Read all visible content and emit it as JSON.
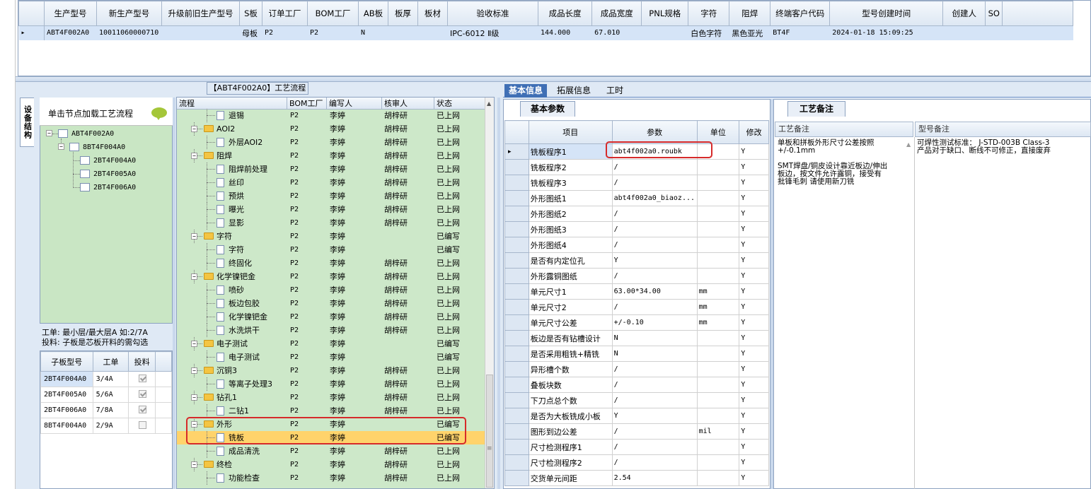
{
  "top_grid": {
    "headers": [
      "生产型号",
      "新生产型号",
      "升级前旧生产型号",
      "S板",
      "订单工厂",
      "BOM工厂",
      "AB板",
      "板厚",
      "板材",
      "验收标准",
      "成品长度",
      "成品宽度",
      "PNL规格",
      "字符",
      "阻焊",
      "终端客户代码",
      "型号创建时间",
      "创建人",
      "SO"
    ],
    "row": [
      "ABT4F002A0",
      "10011060000710",
      "",
      "母板",
      "P2",
      "P2",
      "N",
      "",
      "",
      "IPC-6012 Ⅱ级",
      "144.000",
      "67.010",
      "",
      "白色字符",
      "黑色亚光",
      "BT4F",
      "2024-01-18 15:09:25",
      "",
      ""
    ]
  },
  "side_tab": "设备结构",
  "tree_panel": {
    "header": "单击节点加载工艺流程",
    "nodes": [
      "ABT4F002A0",
      "8BT4F004A0",
      "2BT4F004A0",
      "2BT4F005A0",
      "2BT4F006A0"
    ]
  },
  "hint": {
    "line1": "工单: 最小层/最大层A 如:2/7A",
    "line2": "投料: 子板是芯板开料的需勾选"
  },
  "sub_grid": {
    "headers": [
      "子板型号",
      "工单",
      "投料"
    ],
    "rows": [
      {
        "model": "2BT4F004A0",
        "order": "3/4A",
        "checked": true
      },
      {
        "model": "2BT4F005A0",
        "order": "5/6A",
        "checked": true
      },
      {
        "model": "2BT4F006A0",
        "order": "7/8A",
        "checked": true
      },
      {
        "model": "8BT4F004A0",
        "order": "2/9A",
        "checked": false
      }
    ]
  },
  "process": {
    "title": "【ABT4F002A0】工艺流程",
    "headers": [
      "流程",
      "BOM工厂",
      "编写人",
      "核审人",
      "状态"
    ],
    "rows": [
      {
        "name": "退锡",
        "type": "doc",
        "bom": "P2",
        "writer": "李婷",
        "reviewer": "胡梓研",
        "status": "已上网"
      },
      {
        "name": "AOI2",
        "type": "folder",
        "bom": "P2",
        "writer": "李婷",
        "reviewer": "胡梓研",
        "status": "已上网"
      },
      {
        "name": "外层AOI2",
        "type": "doc",
        "bom": "P2",
        "writer": "李婷",
        "reviewer": "胡梓研",
        "status": "已上网"
      },
      {
        "name": "阻焊",
        "type": "folder",
        "bom": "P2",
        "writer": "李婷",
        "reviewer": "胡梓研",
        "status": "已上网"
      },
      {
        "name": "阻焊前处理",
        "type": "doc",
        "bom": "P2",
        "writer": "李婷",
        "reviewer": "胡梓研",
        "status": "已上网"
      },
      {
        "name": "丝印",
        "type": "doc",
        "bom": "P2",
        "writer": "李婷",
        "reviewer": "胡梓研",
        "status": "已上网"
      },
      {
        "name": "预烘",
        "type": "doc",
        "bom": "P2",
        "writer": "李婷",
        "reviewer": "胡梓研",
        "status": "已上网"
      },
      {
        "name": "曝光",
        "type": "doc",
        "bom": "P2",
        "writer": "李婷",
        "reviewer": "胡梓研",
        "status": "已上网"
      },
      {
        "name": "显影",
        "type": "doc",
        "bom": "P2",
        "writer": "李婷",
        "reviewer": "胡梓研",
        "status": "已上网"
      },
      {
        "name": "字符",
        "type": "folder",
        "bom": "P2",
        "writer": "李婷",
        "reviewer": "",
        "status": "已编写"
      },
      {
        "name": "字符",
        "type": "doc",
        "bom": "P2",
        "writer": "李婷",
        "reviewer": "",
        "status": "已编写"
      },
      {
        "name": "终固化",
        "type": "doc",
        "bom": "P2",
        "writer": "李婷",
        "reviewer": "胡梓研",
        "status": "已上网"
      },
      {
        "name": "化学镍钯金",
        "type": "folder",
        "bom": "P2",
        "writer": "李婷",
        "reviewer": "胡梓研",
        "status": "已上网"
      },
      {
        "name": "喷砂",
        "type": "doc",
        "bom": "P2",
        "writer": "李婷",
        "reviewer": "胡梓研",
        "status": "已上网"
      },
      {
        "name": "板边包胶",
        "type": "doc",
        "bom": "P2",
        "writer": "李婷",
        "reviewer": "胡梓研",
        "status": "已上网"
      },
      {
        "name": "化学镍钯金",
        "type": "doc",
        "bom": "P2",
        "writer": "李婷",
        "reviewer": "胡梓研",
        "status": "已上网"
      },
      {
        "name": "水洗烘干",
        "type": "doc",
        "bom": "P2",
        "writer": "李婷",
        "reviewer": "胡梓研",
        "status": "已上网"
      },
      {
        "name": "电子测试",
        "type": "folder",
        "bom": "P2",
        "writer": "李婷",
        "reviewer": "",
        "status": "已编写"
      },
      {
        "name": "电子测试",
        "type": "doc",
        "bom": "P2",
        "writer": "李婷",
        "reviewer": "",
        "status": "已编写"
      },
      {
        "name": "沉铜3",
        "type": "folder",
        "bom": "P2",
        "writer": "李婷",
        "reviewer": "胡梓研",
        "status": "已上网"
      },
      {
        "name": "等离子处理3",
        "type": "doc",
        "bom": "P2",
        "writer": "李婷",
        "reviewer": "胡梓研",
        "status": "已上网"
      },
      {
        "name": "钻孔1",
        "type": "folder",
        "bom": "P2",
        "writer": "李婷",
        "reviewer": "胡梓研",
        "status": "已上网"
      },
      {
        "name": "二钻1",
        "type": "doc",
        "bom": "P2",
        "writer": "李婷",
        "reviewer": "胡梓研",
        "status": "已上网"
      },
      {
        "name": "外形",
        "type": "folder",
        "bom": "P2",
        "writer": "李婷",
        "reviewer": "",
        "status": "已编写"
      },
      {
        "name": "铣板",
        "type": "doc",
        "bom": "P2",
        "writer": "李婷",
        "reviewer": "",
        "status": "已编写",
        "selected": true
      },
      {
        "name": "成品清洗",
        "type": "doc",
        "bom": "P2",
        "writer": "李婷",
        "reviewer": "胡梓研",
        "status": "已上网"
      },
      {
        "name": "终检",
        "type": "folder",
        "bom": "P2",
        "writer": "李婷",
        "reviewer": "胡梓研",
        "status": "已上网"
      },
      {
        "name": "功能检查",
        "type": "doc",
        "bom": "P2",
        "writer": "李婷",
        "reviewer": "胡梓研",
        "status": "已上网"
      }
    ]
  },
  "right_tabs": [
    "基本信息",
    "拓展信息",
    "工时"
  ],
  "basic_params": {
    "tab": "基本参数",
    "headers": [
      "项目",
      "参数",
      "单位",
      "修改"
    ],
    "rows": [
      {
        "item": "铣板程序1",
        "param": "abt4f002a0.roubk",
        "unit": "",
        "mod": "Y"
      },
      {
        "item": "铣板程序2",
        "param": "/",
        "unit": "",
        "mod": "Y"
      },
      {
        "item": "铣板程序3",
        "param": "/",
        "unit": "",
        "mod": "Y"
      },
      {
        "item": "外形图纸1",
        "param": "abt4f002a0_biaoz...",
        "unit": "",
        "mod": "Y"
      },
      {
        "item": "外形图纸2",
        "param": "/",
        "unit": "",
        "mod": "Y"
      },
      {
        "item": "外形图纸3",
        "param": "/",
        "unit": "",
        "mod": "Y"
      },
      {
        "item": "外形图纸4",
        "param": "/",
        "unit": "",
        "mod": "Y"
      },
      {
        "item": "是否有内定位孔",
        "param": "Y",
        "unit": "",
        "mod": "Y"
      },
      {
        "item": "外形露铜图纸",
        "param": "/",
        "unit": "",
        "mod": "Y"
      },
      {
        "item": "单元尺寸1",
        "param": "63.00*34.00",
        "unit": "mm",
        "mod": "Y"
      },
      {
        "item": "单元尺寸2",
        "param": "/",
        "unit": "mm",
        "mod": "Y"
      },
      {
        "item": "单元尺寸公差",
        "param": "+/-0.10",
        "unit": "mm",
        "mod": "Y"
      },
      {
        "item": "板边是否有钻槽设计",
        "param": "N",
        "unit": "",
        "mod": "Y"
      },
      {
        "item": "是否采用粗铣+精铣",
        "param": "N",
        "unit": "",
        "mod": "Y"
      },
      {
        "item": "异形槽个数",
        "param": "/",
        "unit": "",
        "mod": "Y"
      },
      {
        "item": "叠板块数",
        "param": "/",
        "unit": "",
        "mod": "Y"
      },
      {
        "item": "下刀点总个数",
        "param": "/",
        "unit": "",
        "mod": "Y"
      },
      {
        "item": "是否为大板铣成小板",
        "param": "Y",
        "unit": "",
        "mod": "Y"
      },
      {
        "item": "图形到边公差",
        "param": "/",
        "unit": "mil",
        "mod": "Y"
      },
      {
        "item": "尺寸检测程序1",
        "param": "/",
        "unit": "",
        "mod": "Y"
      },
      {
        "item": "尺寸检测程序2",
        "param": "/",
        "unit": "",
        "mod": "Y"
      },
      {
        "item": "交货单元间距",
        "param": "2.54",
        "unit": "",
        "mod": "Y"
      }
    ]
  },
  "process_notes": {
    "tab": "工艺备注",
    "col1_header": "工艺备注",
    "col2_header": "型号备注",
    "col1_text": "单板和拼板外形尺寸公差按照\n+/-0.1mm\n\nSMT焊盘/铜皮设计靠近板边/伸出\n板边，按文件允许露铜，接受有\n批锋毛刺 请使用新刀铣",
    "col2_text": "可焊性测试标准： J-STD-003B Class-3\n产品对于缺口、断线不可修正，直接废弃"
  }
}
